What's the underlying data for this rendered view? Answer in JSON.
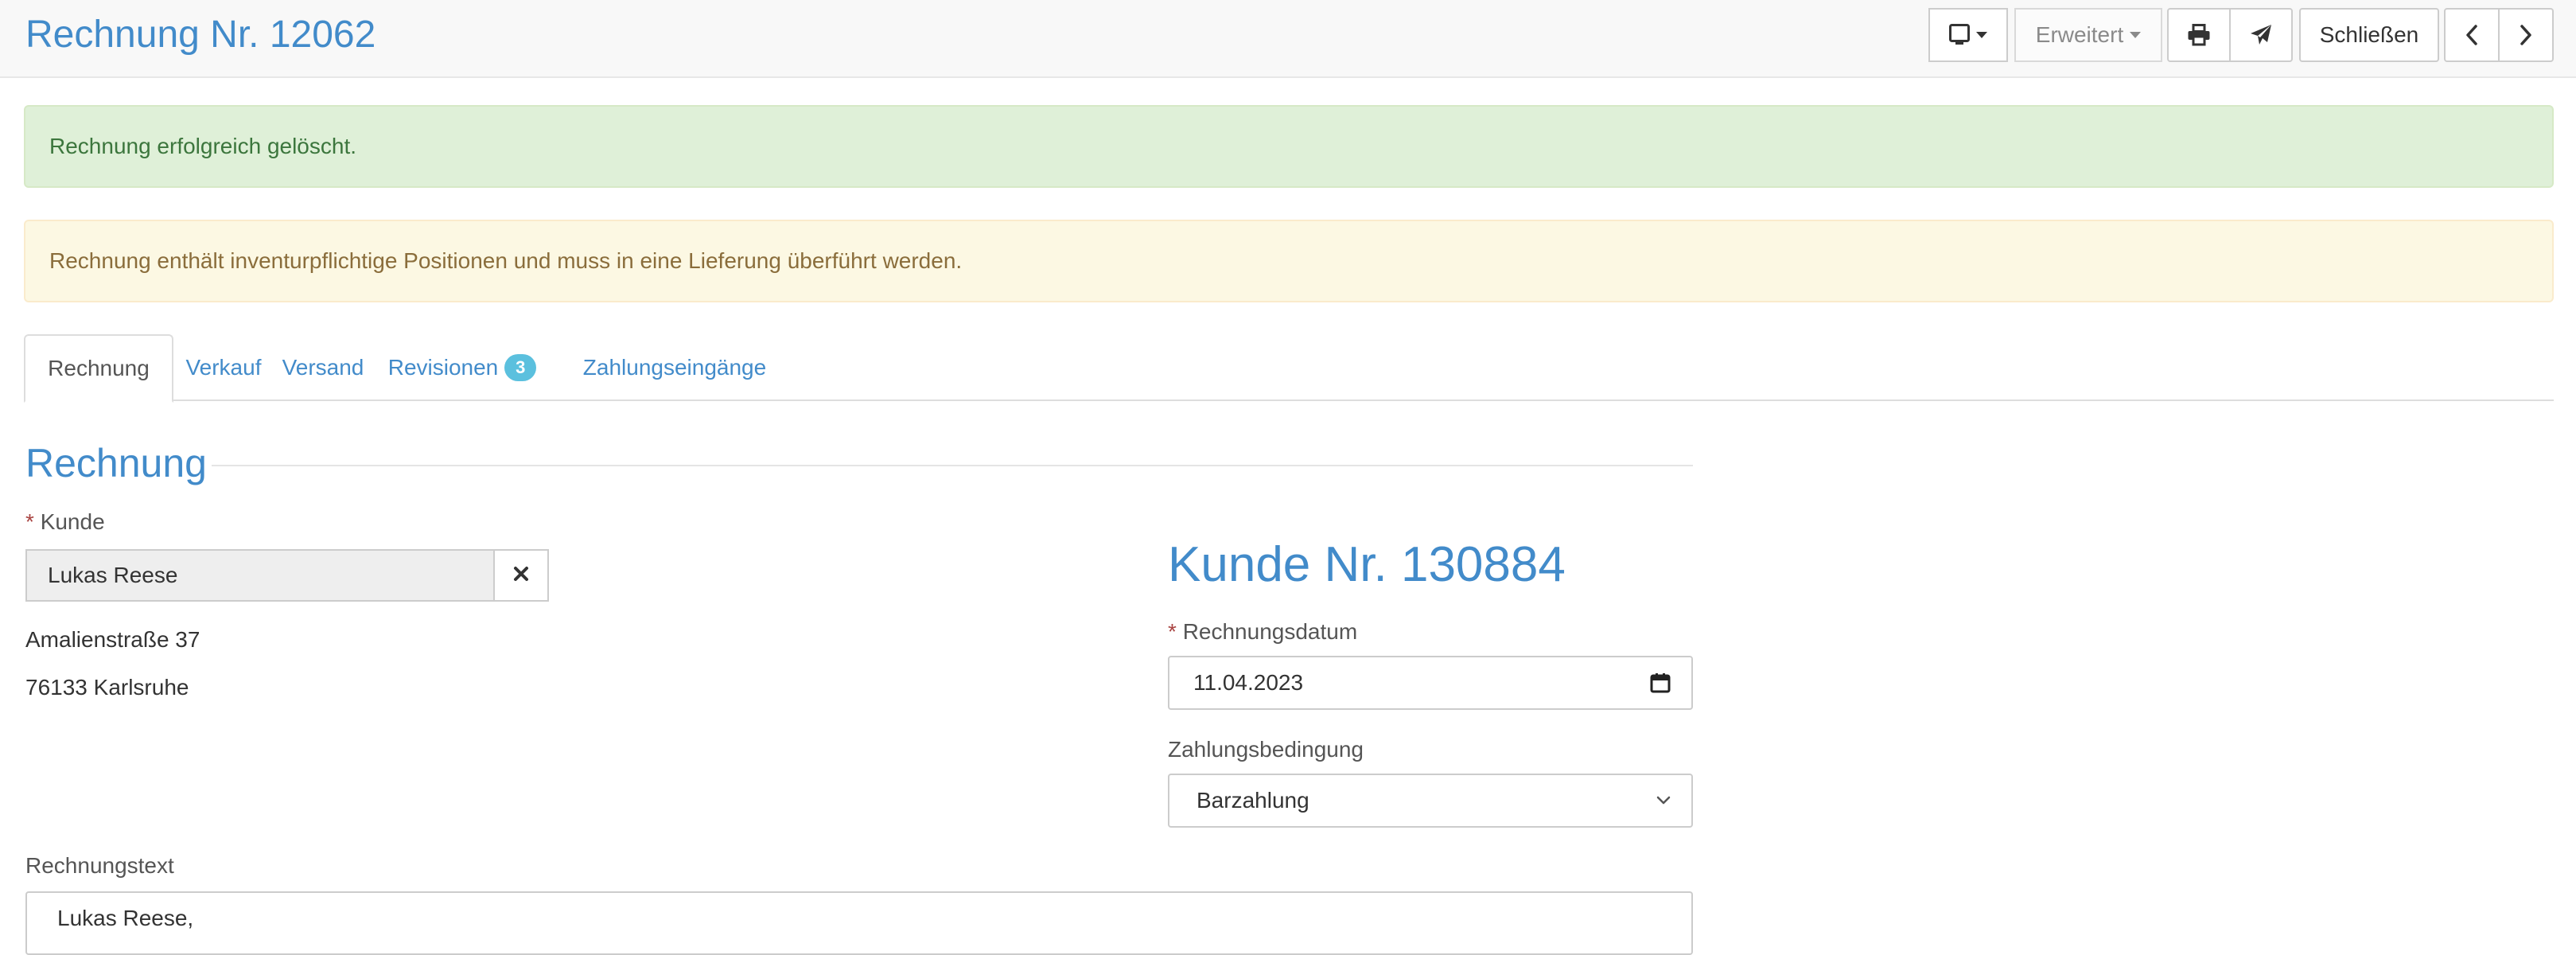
{
  "header": {
    "title": "Rechnung Nr. 12062",
    "buttons": {
      "erweitert_label": "Erweitert",
      "close_label": "Schließen"
    }
  },
  "alerts": {
    "success": "Rechnung erfolgreich gelöscht.",
    "warning": "Rechnung enthält inventurpflichtige Positionen und muss in eine Lieferung überführt werden."
  },
  "tabs": [
    {
      "label": "Rechnung",
      "active": true
    },
    {
      "label": "Verkauf"
    },
    {
      "label": "Versand"
    },
    {
      "label": "Revisionen",
      "badge": "3"
    },
    {
      "label": "Zahlungseingänge"
    }
  ],
  "section": {
    "title": "Rechnung"
  },
  "customer": {
    "label": "Kunde",
    "value": "Lukas Reese",
    "address_line1": "Amalienstraße 37",
    "address_line2": "76133 Karlsruhe",
    "number_heading": "Kunde Nr. 130884"
  },
  "invoice": {
    "date_label": "Rechnungsdatum",
    "date_value": "11.04.2023",
    "payment_label": "Zahlungsbedingung",
    "payment_value": "Barzahlung",
    "text_label": "Rechnungstext",
    "text_value": "Lukas Reese,"
  },
  "icons": {
    "device": "tablet-icon",
    "print": "print-icon",
    "send": "paper-plane-icon",
    "prev": "chevron-left-icon",
    "next": "chevron-right-icon",
    "clear": "close-icon",
    "calendar": "calendar-icon",
    "select": "chevron-down-icon"
  },
  "colors": {
    "primary": "#428bca",
    "success_bg": "#dff0d8",
    "success_text": "#3c763d",
    "warning_bg": "#fcf8e3",
    "warning_text": "#8a6d3b",
    "required": "#a94442",
    "badge": "#5bc0de"
  }
}
